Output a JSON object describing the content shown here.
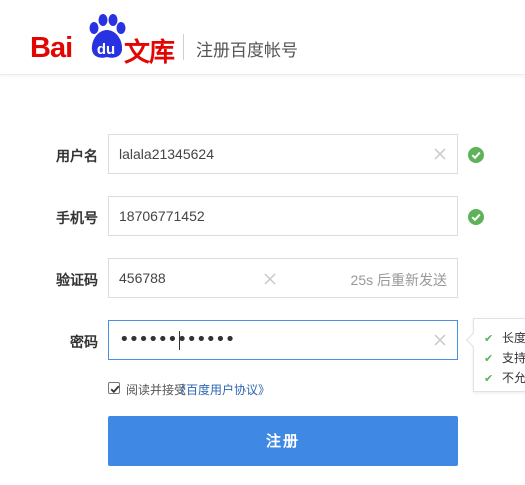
{
  "header": {
    "logo_bai": "Bai",
    "logo_du": "du",
    "logo_wenku": "文库",
    "title": "注册百度帐号"
  },
  "form": {
    "username": {
      "label": "用户名",
      "value": "lalala21345624",
      "status": "valid"
    },
    "phone": {
      "label": "手机号",
      "value": "18706771452",
      "status": "valid"
    },
    "code": {
      "label": "验证码",
      "value": "456788",
      "resend": "25s 后重新发送"
    },
    "password": {
      "label": "密码",
      "masked": "••••••••••••"
    }
  },
  "password_tips": [
    "长度",
    "支持",
    "不允"
  ],
  "agreement": {
    "checked": true,
    "text": "阅读并接受",
    "link": "《百度用户协议》"
  },
  "submit_label": "注册",
  "colors": {
    "brand_red": "#e10602",
    "brand_blue": "#2932e1",
    "button_blue": "#3f88e4",
    "valid_green": "#5db25a",
    "focus_border": "#4a90e2"
  }
}
